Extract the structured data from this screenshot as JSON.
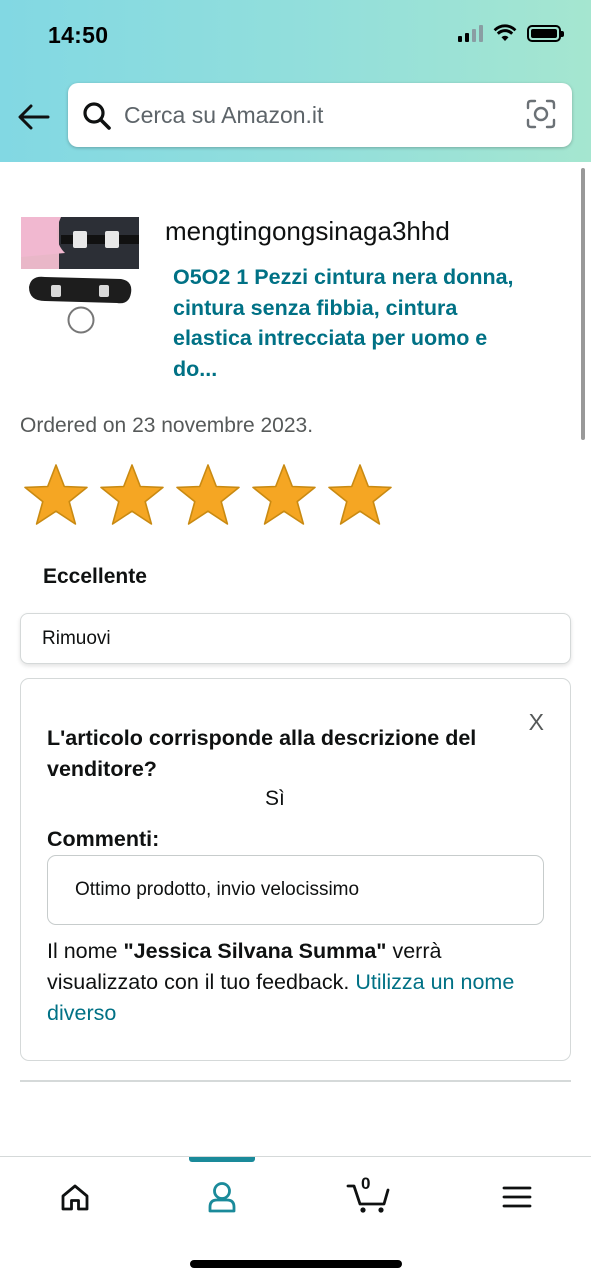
{
  "status_bar": {
    "time": "14:50"
  },
  "search": {
    "placeholder": "Cerca su Amazon.it"
  },
  "order": {
    "seller": "mengtingongsinaga3hhd",
    "product_title": "O5O2 1 Pezzi cintura nera donna, cintura senza fibbia, cintura elastica intrecciata per uomo e do...",
    "ordered_text": "Ordered on 23 novembre 2023."
  },
  "rating": {
    "stars": 5,
    "max": 5,
    "label": "Eccellente",
    "color": "#f5a623"
  },
  "remove_label": "Rimuovi",
  "feedback": {
    "close_label": "X",
    "question": "L'articolo corrisponde alla descrizione del venditore?",
    "answer": "Sì",
    "comments_label": "Commenti:",
    "comment_value": "Ottimo prodotto, invio velocissimo",
    "name_prefix": "Il nome ",
    "name": "\"Jessica Silvana Summa\"",
    "name_suffix": " verrà visualizzato con il tuo feedback. ",
    "change_name_link": "Utilizza un nome diverso"
  },
  "tabbar": {
    "items": [
      "home-icon",
      "account-icon",
      "cart-icon",
      "menu-icon"
    ],
    "cart_count": "0",
    "active_color": "#1a8a9a"
  },
  "colors": {
    "link": "#007185",
    "header_gradient": [
      "#82d8e3",
      "#a5e6d0"
    ]
  }
}
